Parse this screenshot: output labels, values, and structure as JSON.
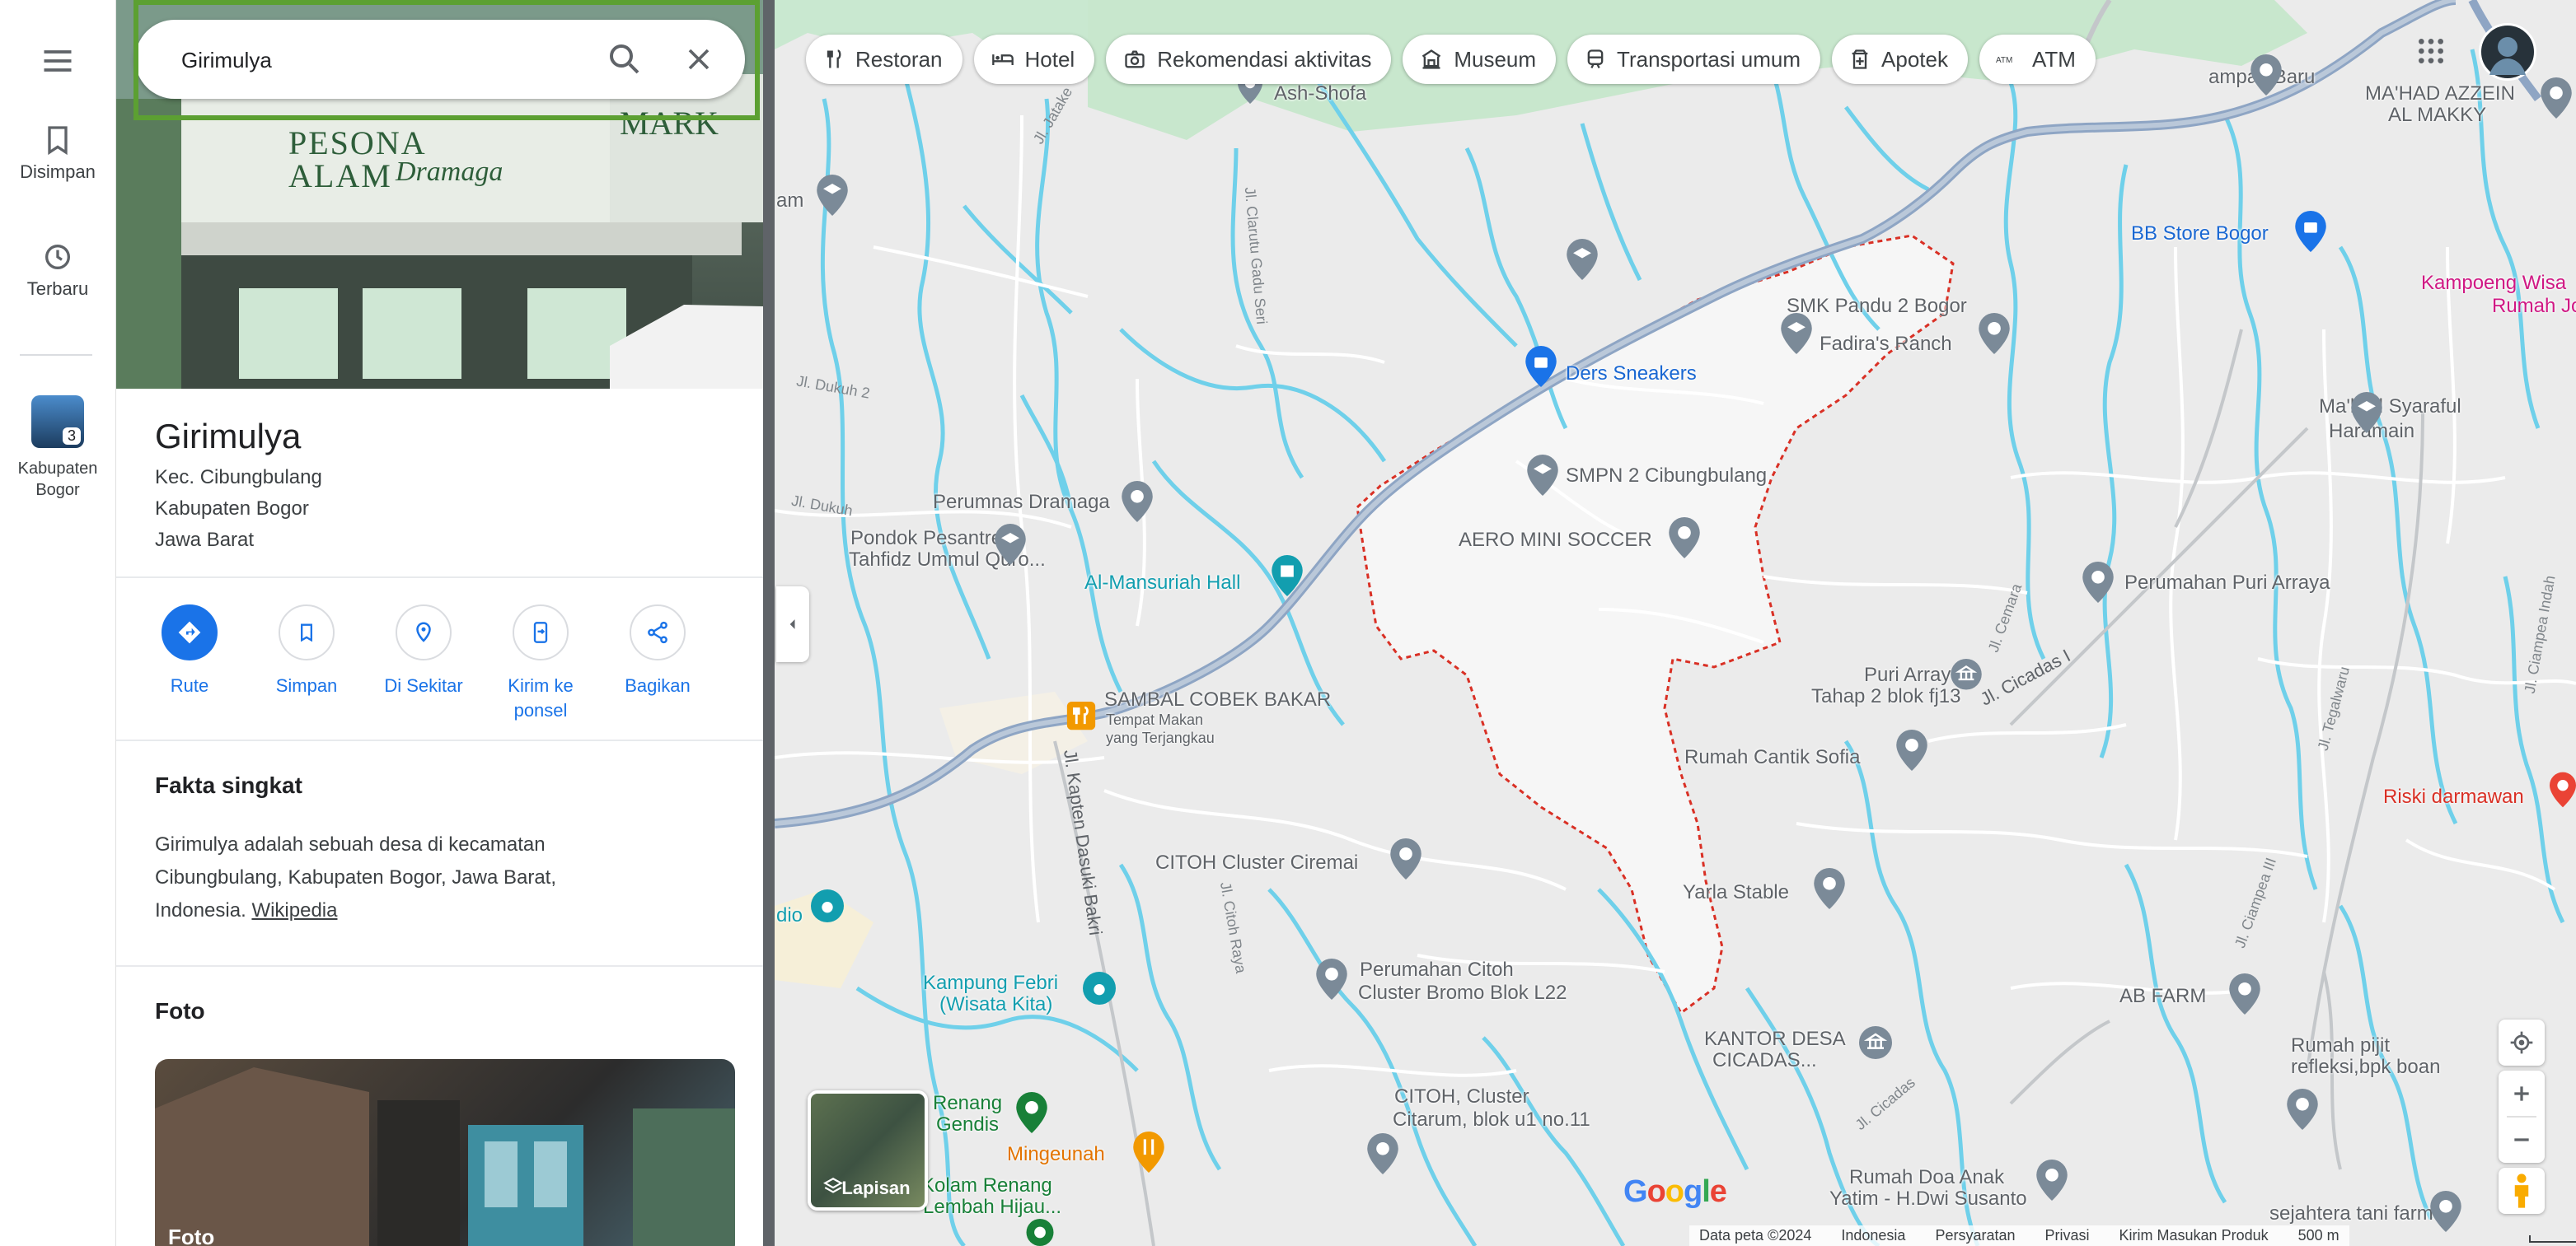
{
  "search": {
    "value": "Girimulya"
  },
  "rail": {
    "saved": "Disimpan",
    "recent": "Terbaru",
    "recent_place_line1": "Kabupaten",
    "recent_place_line2": "Bogor",
    "recent_badge": "3"
  },
  "hero": {
    "sign_line1": "PESONA",
    "sign_line2": "ALAM",
    "sign_script": "Dramaga",
    "sign_right": "MARK"
  },
  "place": {
    "title": "Girimulya",
    "address": [
      "Kec. Cibungbulang",
      "Kabupaten Bogor",
      "Jawa Barat"
    ]
  },
  "actions": [
    {
      "label": "Rute"
    },
    {
      "label": "Simpan"
    },
    {
      "label": "Di Sekitar"
    },
    {
      "label": "Kirim ke ponsel"
    },
    {
      "label": "Bagikan"
    }
  ],
  "facts": {
    "heading": "Fakta singkat",
    "text": "Girimulya adalah sebuah desa di kecamatan Cibungbulang, Kabupaten Bogor, Jawa Barat, Indonesia.",
    "link": "Wikipedia"
  },
  "photos": {
    "heading": "Foto",
    "caption": "Foto"
  },
  "chips": [
    "Restoran",
    "Hotel",
    "Rekomendasi aktivitas",
    "Museum",
    "Transportasi umum",
    "Apotek",
    "ATM"
  ],
  "layers": {
    "label": "Lapisan"
  },
  "map": {
    "places": [
      {
        "name": "Ash-Shofa"
      },
      {
        "name": "SMK Pandu 2 Bogor"
      },
      {
        "name": "Fadira's Ranch"
      },
      {
        "name": "Ders Sneakers"
      },
      {
        "name": "SMPN 2 Cibungbulang"
      },
      {
        "name": "AERO MINI SOCCER"
      },
      {
        "name": "Perumnas Dramaga"
      },
      {
        "name": "Pondok Pesantren"
      },
      {
        "name": "Tahfidz Ummul Quro..."
      },
      {
        "name": "Al-Mansuriah Hall"
      },
      {
        "name": "SAMBAL COBEK BAKAR"
      },
      {
        "name": "Tempat Makan"
      },
      {
        "name": "yang Terjangkau"
      },
      {
        "name": "Puri Arraya"
      },
      {
        "name": "Tahap 2 blok fj13"
      },
      {
        "name": "Rumah Cantik Sofia"
      },
      {
        "name": "CITOH Cluster Ciremai"
      },
      {
        "name": "Yarla Stable"
      },
      {
        "name": "Kampung Febri"
      },
      {
        "name": "(Wisata Kita)"
      },
      {
        "name": "Perumahan Citoh"
      },
      {
        "name": "Cluster Bromo Blok L22"
      },
      {
        "name": "KANTOR DESA"
      },
      {
        "name": "CICADAS..."
      },
      {
        "name": "Renang"
      },
      {
        "name": "Gendis"
      },
      {
        "name": "Mingeunah"
      },
      {
        "name": "CITOH, Cluster"
      },
      {
        "name": "Citarum, blok u1 no.11"
      },
      {
        "name": "Rumah Doa Anak"
      },
      {
        "name": "Yatim - H.Dwi Susanto"
      },
      {
        "name": "MA'HAD AZZEIN"
      },
      {
        "name": "AL MAKKY"
      },
      {
        "name": "BB Store Bogor"
      },
      {
        "name": "Kampoeng Wisa"
      },
      {
        "name": "Rumah Jo"
      },
      {
        "name": "Ma'had Syaraful"
      },
      {
        "name": "Haramain"
      },
      {
        "name": "Perumahan Puri Arraya"
      },
      {
        "name": "Riski darmawan"
      },
      {
        "name": "AB FARM"
      },
      {
        "name": "Rumah pijit"
      },
      {
        "name": "refleksi,bpk boan"
      },
      {
        "name": "sejahtera tani farm"
      },
      {
        "name": "ampak Baru"
      },
      {
        "name": "Kolam Renang"
      },
      {
        "name": "Lembah Hijau..."
      },
      {
        "name": "am"
      },
      {
        "name": "dio"
      }
    ],
    "streets": [
      "Jl. Jatake",
      "Jl. Clarutu Gadu Seri",
      "Jl. Dukuh 2",
      "Jl. Dukuh",
      "Jl. Kapten Dasuki Bakri",
      "Jl. Cicadas I",
      "Jl. Cemara",
      "Jl. Tegalwaru",
      "Jl. Ciampea Indah",
      "Jl. Ciampea III",
      "Jl. Cicadas",
      "Jl. Citoh Raya"
    ]
  },
  "footer": {
    "data": "Data peta ©2024",
    "region": "Indonesia",
    "terms": "Persyaratan",
    "privacy": "Privasi",
    "feedback": "Kirim Masukan Produk",
    "scale": "500 m"
  },
  "brand": {
    "logo": "Google"
  },
  "colors": {
    "accent": "#1a73e8",
    "highlight": "#5ca032",
    "boundary": "#d93025"
  }
}
